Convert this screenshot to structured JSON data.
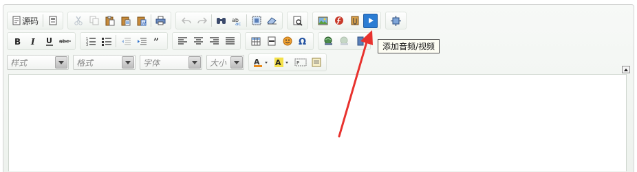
{
  "toolbar": {
    "source_label": "源码",
    "tooltip": "添加音频/视频",
    "style_combo": "样式",
    "format_combo": "格式",
    "font_combo": "字体",
    "size_combo": "大小"
  },
  "annotation": {
    "arrow_color": "#e8322e"
  },
  "icons": [
    "source-icon",
    "template-icon",
    "cut-icon",
    "copy-icon",
    "paste-icon",
    "paste-text-icon",
    "paste-word-icon",
    "print-icon",
    "undo-icon",
    "redo-icon",
    "find-icon",
    "replace-icon",
    "select-all-icon",
    "remove-format-icon",
    "preview-icon",
    "image-icon",
    "flash-icon",
    "attachment-icon",
    "video-icon",
    "maximize-icon",
    "bold-icon",
    "italic-icon",
    "underline-icon",
    "strike-icon",
    "numbered-list-icon",
    "bullet-list-icon",
    "outdent-icon",
    "indent-icon",
    "blockquote-icon",
    "align-left-icon",
    "align-center-icon",
    "align-right-icon",
    "justify-icon",
    "table-icon",
    "horizontal-rule-icon",
    "smiley-icon",
    "special-char-icon",
    "link-icon",
    "unlink-icon",
    "anchor-icon",
    "text-color-icon",
    "bg-color-icon",
    "show-blocks-icon",
    "page-break-icon"
  ]
}
